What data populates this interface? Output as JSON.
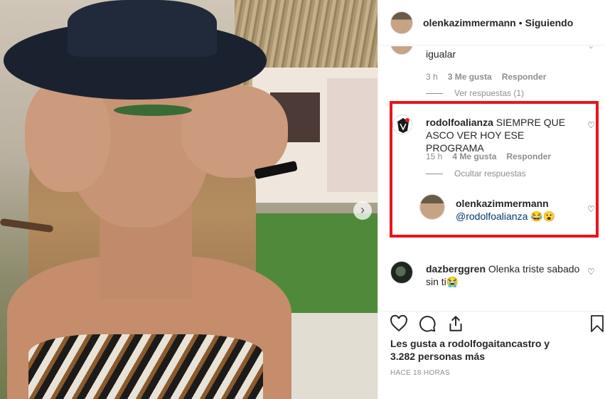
{
  "header": {
    "username": "olenkazimmermann",
    "separator": "•",
    "follow_status": "Siguiendo"
  },
  "comments": [
    {
      "text": "igualar",
      "time": "3 h",
      "likes": "3 Me gusta",
      "reply": "Responder",
      "replies_toggle": "Ver respuestas (1)"
    },
    {
      "username": "rodolfoalianza",
      "text": "SIEMPRE QUE ASCO VER HOY ESE PROGRAMA",
      "time": "15 h",
      "likes": "4 Me gusta",
      "reply": "Responder",
      "replies_toggle": "Ocultar respuestas",
      "replies": [
        {
          "username": "olenkazimmermann",
          "text": "@rodolfoalianza 😂😮"
        }
      ]
    },
    {
      "username": "dazberggren",
      "text": "Olenka triste sabado sin ti😭"
    }
  ],
  "footer": {
    "likes_line1": "Les gusta a rodolfogaitancastro y",
    "likes_line2": "3.282 personas más",
    "timestamp": "HACE 18 HORAS"
  },
  "icons": {
    "heart": "heart-icon",
    "comment": "comment-icon",
    "share": "share-icon",
    "save": "bookmark-icon",
    "next": "chevron-right-icon"
  },
  "colors": {
    "highlight": "#e8141c",
    "muted": "#8e8e8e",
    "text": "#262626"
  }
}
